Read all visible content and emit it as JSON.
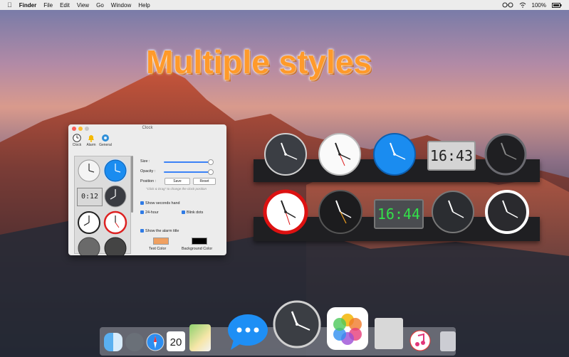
{
  "menubar": {
    "app": "Finder",
    "menus": [
      "File",
      "Edit",
      "View",
      "Go",
      "Window",
      "Help"
    ],
    "battery": "100%"
  },
  "headline": "Multiple styles",
  "window": {
    "title": "Clock",
    "toolbar": [
      "Clock",
      "Alarm",
      "General"
    ],
    "size_label": "Size :",
    "opacity_label": "Opacity :",
    "position_label": "Position :",
    "save_label": "Save",
    "reset_label": "Reset",
    "hint": "\"Click & Drag\" to change the clock position",
    "show_seconds": "Show seconds hand",
    "h24": "24-hour",
    "blink": "Blink dots",
    "alarm_title": "Show the alarm title",
    "text_color": "Text Color",
    "bg_color": "Background Color",
    "digital_cell": "0:12"
  },
  "digital_clocks": [
    "16:43",
    "16:44"
  ],
  "dock": {
    "calendar_day": "20"
  },
  "colors": {
    "headline": "#ff9a2a",
    "accent": "#2f7be5",
    "text_swatch": "#f0a060",
    "bg_swatch": "#000000"
  }
}
